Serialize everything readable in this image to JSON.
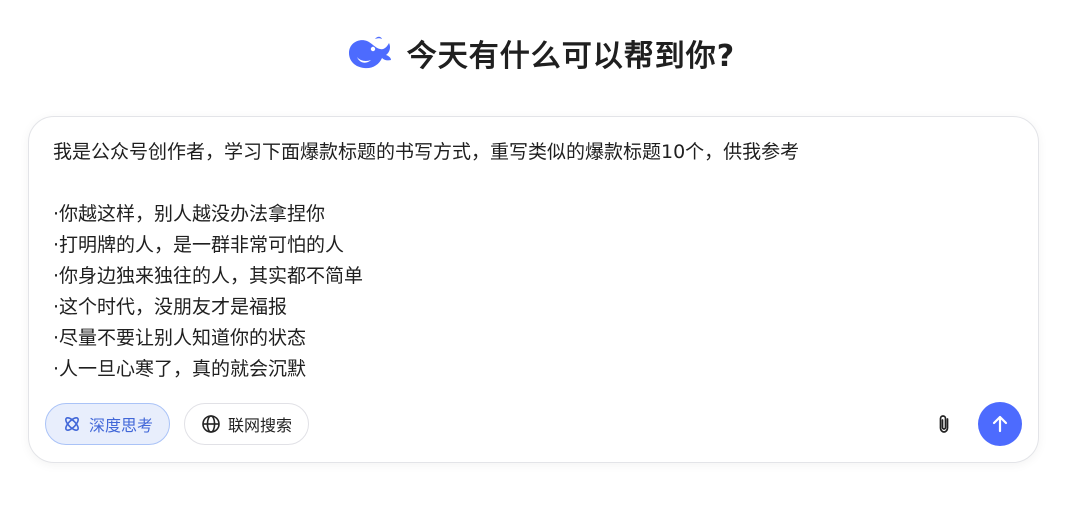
{
  "header": {
    "logo_icon": "deepseek-whale-icon",
    "greeting": "今天有什么可以帮到你?"
  },
  "composer": {
    "prompt_lines": [
      "我是公众号创作者，学习下面爆款标题的书写方式，重写类似的爆款标题10个，供我参考",
      "",
      "·你越这样，别人越没办法拿捏你",
      "·打明牌的人，是一群非常可怕的人",
      "·你身边独来独往的人，其实都不简单",
      "·这个时代，没朋友才是福报",
      "·尽量不要让别人知道你的状态",
      "·人一旦心寒了，真的就会沉默"
    ],
    "deep_think_label": "深度思考",
    "web_search_label": "联网搜索",
    "attach_icon": "paperclip-icon",
    "send_icon": "arrow-up-icon"
  },
  "colors": {
    "accent": "#4d6bfe",
    "deep_think_bg": "#e8eefc",
    "deep_think_text": "#4167d8"
  }
}
